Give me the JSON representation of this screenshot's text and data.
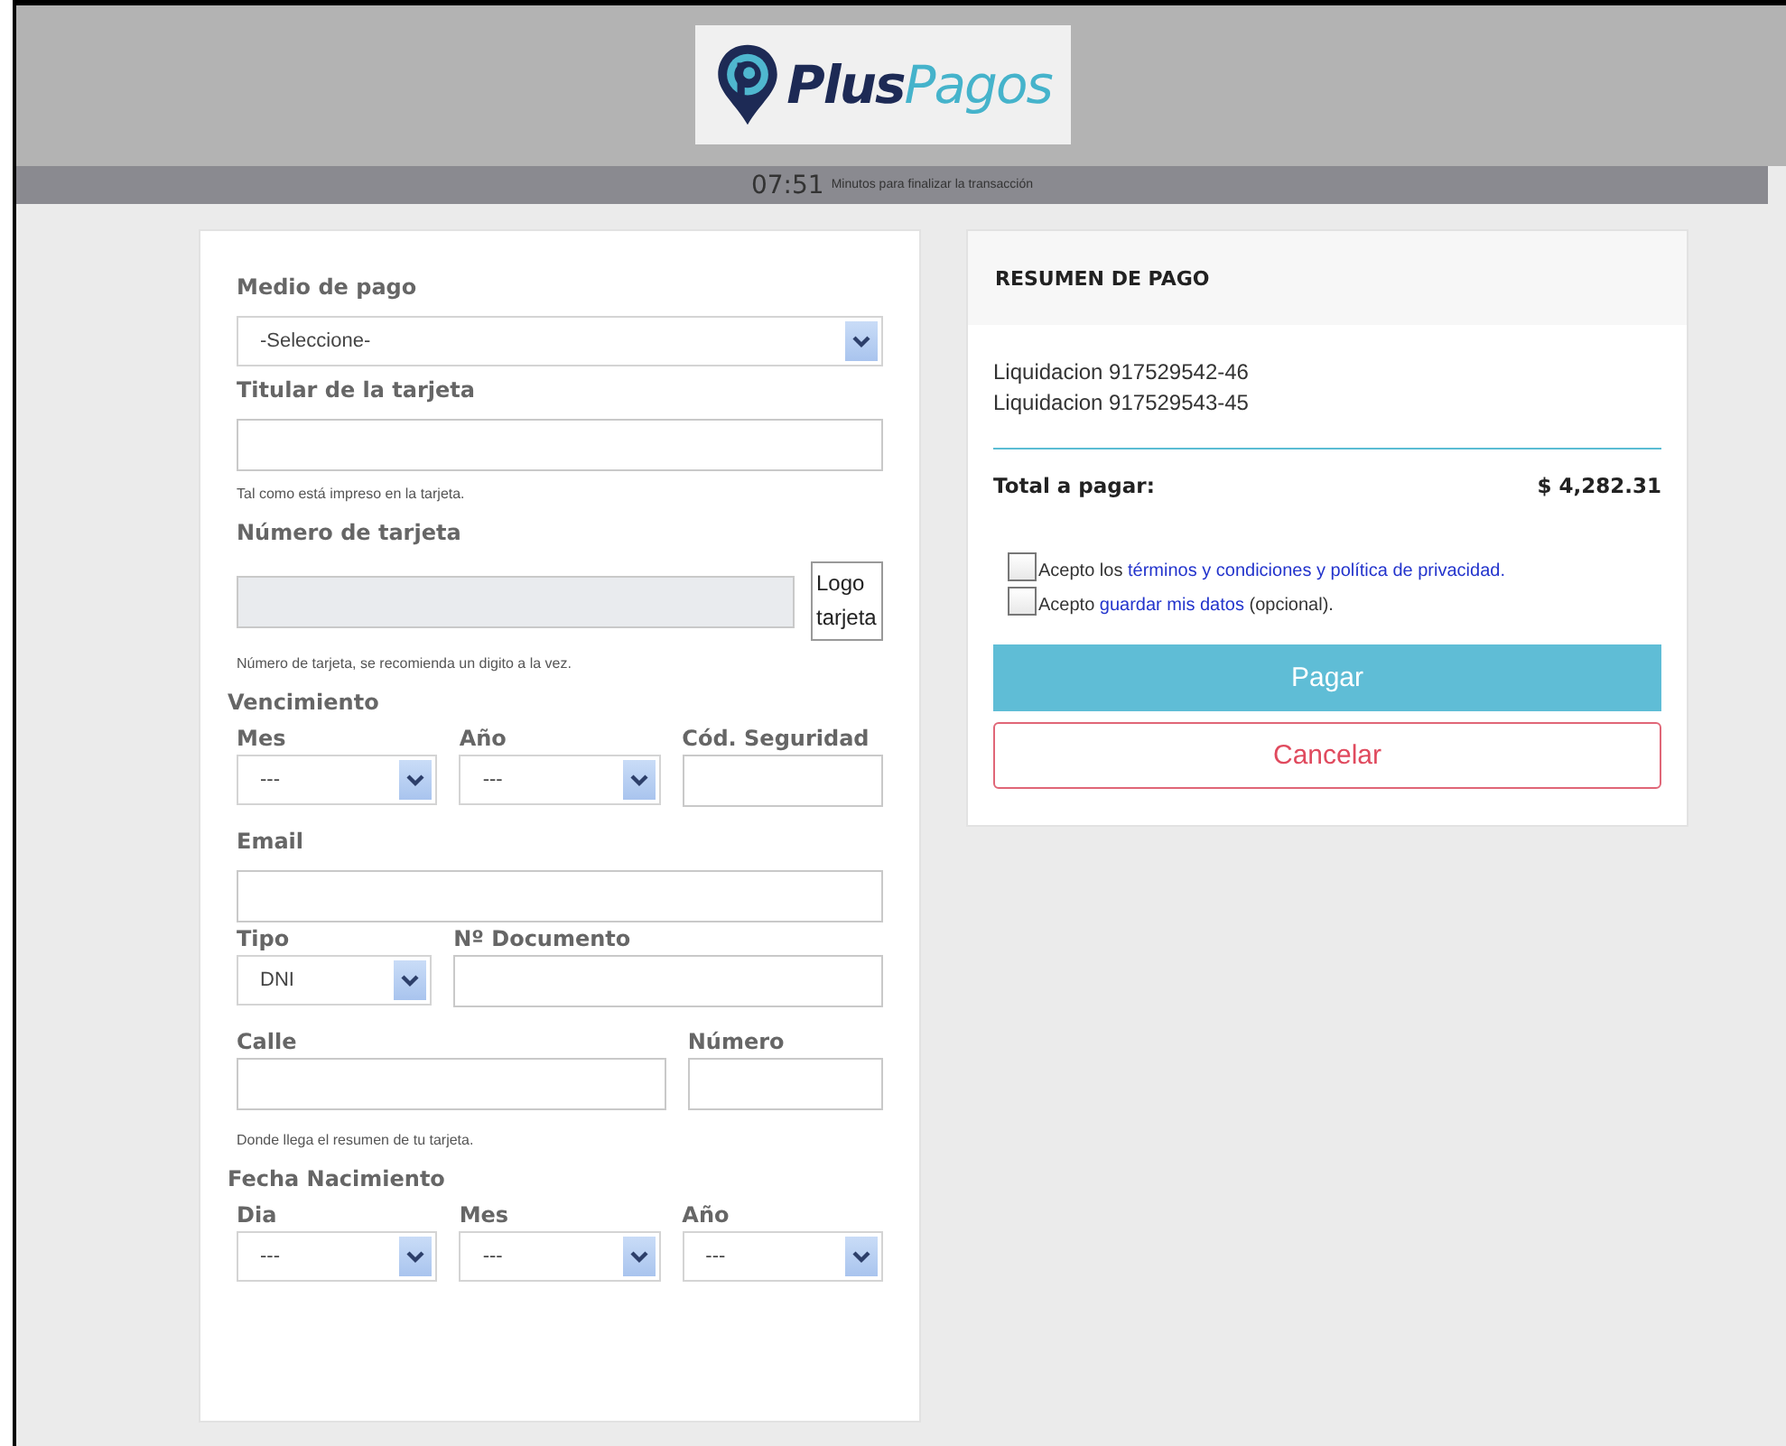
{
  "header": {
    "logo": {
      "text_1": "Plus",
      "text_2": "Pagos"
    },
    "timer": {
      "time": "07:51",
      "message": "Minutos para finalizar la transacción"
    }
  },
  "form": {
    "items": [
      {
        "kind": "select",
        "label": "Medio de pago",
        "value": "-Seleccione-"
      },
      {
        "kind": "input",
        "label": "Titular de la tarjeta"
      },
      {
        "kind": "hint",
        "text": "Tal como está impreso en la tarjeta."
      },
      {
        "kind": "input",
        "label": "Número de tarjeta",
        "disabled": true,
        "aside": "Logo tarjeta"
      },
      {
        "kind": "hint",
        "text": "Número de tarjeta, se recomienda un digito a la vez."
      },
      {
        "kind": "heading",
        "text": "Vencimiento"
      },
      {
        "kind": "row",
        "fields": [
          {
            "label": "Mes",
            "kind": "select",
            "value": "---"
          },
          {
            "label": "Año",
            "kind": "select",
            "value": "---"
          },
          {
            "label": "Cód. Seguridad",
            "kind": "input"
          }
        ]
      },
      {
        "kind": "input",
        "label": "Email"
      },
      {
        "kind": "row",
        "fields": [
          {
            "label": "Tipo",
            "kind": "select",
            "value": "DNI",
            "wide": false
          },
          {
            "label": "Nº Documento",
            "kind": "input",
            "wide": true
          }
        ]
      },
      {
        "kind": "row",
        "fields": [
          {
            "label": "Calle",
            "kind": "input",
            "wide": true
          },
          {
            "label": "Número",
            "kind": "input",
            "wide": false
          }
        ]
      },
      {
        "kind": "hint",
        "text": "Donde llega el resumen de tu tarjeta."
      },
      {
        "kind": "heading",
        "text": "Fecha Nacimiento"
      },
      {
        "kind": "row",
        "fields": [
          {
            "label": "Dia",
            "kind": "select",
            "value": "---"
          },
          {
            "label": "Mes",
            "kind": "select",
            "value": "---"
          },
          {
            "label": "Año",
            "kind": "select",
            "value": "---"
          }
        ]
      }
    ]
  },
  "summary": {
    "title": "RESUMEN DE PAGO",
    "items": [
      "Liquidacion 917529542-46",
      "Liquidacion 917529543-45"
    ],
    "total": {
      "label": "Total a pagar:",
      "amount": "$ 4,282.31"
    },
    "consents": [
      {
        "checked": false,
        "parts": [
          {
            "text": "Acepto los ",
            "link": false
          },
          {
            "text": "términos y condiciones y política de privacidad.",
            "link": true
          }
        ]
      },
      {
        "checked": false,
        "parts": [
          {
            "text": "Acepto ",
            "link": false
          },
          {
            "text": "guardar mis datos",
            "link": true
          },
          {
            "text": " (opcional).",
            "link": false
          }
        ]
      }
    ],
    "buttons": [
      {
        "label": "Pagar",
        "kind": "primary"
      },
      {
        "label": "Cancelar",
        "kind": "outline"
      }
    ]
  }
}
